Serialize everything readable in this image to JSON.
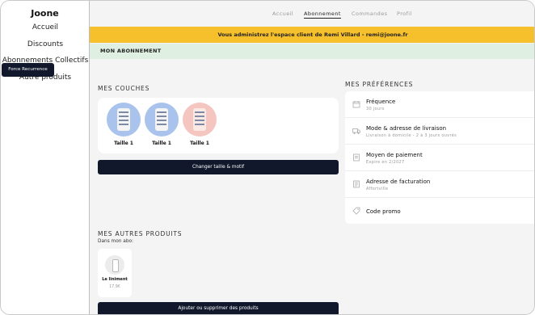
{
  "sidebar": {
    "brand": "Joone",
    "items": [
      {
        "label": "Accueil"
      },
      {
        "label": "Discounts"
      },
      {
        "label": "Abonnements Collectifs"
      },
      {
        "label": "Autre produits"
      }
    ]
  },
  "topnav": {
    "tabs": [
      {
        "label": "Accueil"
      },
      {
        "label": "Abonnement"
      },
      {
        "label": "Commandes"
      },
      {
        "label": "Profil"
      }
    ],
    "active": "Abonnement"
  },
  "banner": {
    "text": "Vous administrez l'espace client de Remi Villard - remi@joone.fr"
  },
  "subbar": {
    "title": "MON ABONNEMENT"
  },
  "force_button": {
    "label": "Force Recurrence"
  },
  "couches": {
    "title": "MES COUCHES",
    "items": [
      {
        "label": "Taille 1",
        "color": "#a9c3ec"
      },
      {
        "label": "Taille 1",
        "color": "#a9c3ec"
      },
      {
        "label": "Taille 1",
        "color": "#f5c6c0"
      }
    ],
    "change_button": "Changer taille & motif"
  },
  "preferences": {
    "title": "MES PRÉFÉRENCES",
    "rows": [
      {
        "title": "Fréquence",
        "sub": "30 jours",
        "icon": "calendar-icon"
      },
      {
        "title": "Mode & adresse de livraison",
        "sub": "Livraison à domicile - 2 à 3 jours ouvrés",
        "icon": "truck-icon"
      },
      {
        "title": "Moyen de paiement",
        "sub": "Expire en 2/2027",
        "icon": "card-icon"
      },
      {
        "title": "Adresse de facturation",
        "sub": "Affortville",
        "icon": "document-icon"
      },
      {
        "title": "Code promo",
        "sub": "",
        "icon": "tag-icon"
      }
    ]
  },
  "products": {
    "title": "MES AUTRES PRODUITS",
    "subtitle": "Dans mon abo:",
    "items": [
      {
        "name": "Le liniment",
        "price": "17,9€"
      }
    ],
    "manage_button": "Ajouter ou supprimer des produits"
  },
  "colors": {
    "accent": "#f6c02c",
    "dark": "#11182b",
    "mint": "#dff0e2",
    "background": "#f4f4f4"
  }
}
